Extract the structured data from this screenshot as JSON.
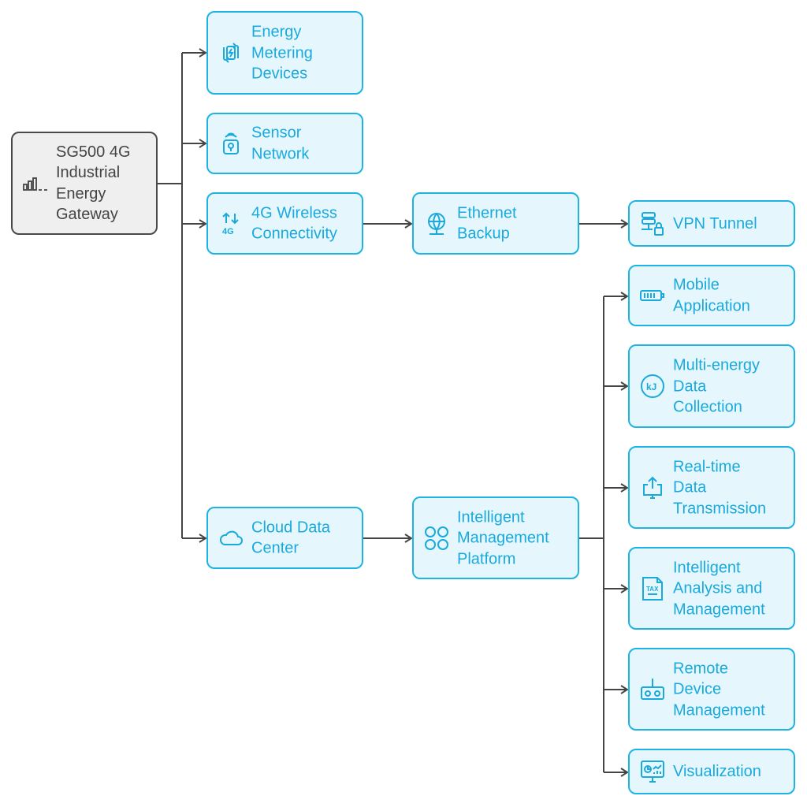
{
  "colors": {
    "node_border": "#1db3e3",
    "node_fill": "#e5f7fd",
    "node_text": "#1aa9dd",
    "root_border": "#4a4a4a",
    "root_fill": "#efefef",
    "root_text": "#444444",
    "connector": "#444444"
  },
  "nodes": {
    "root": {
      "label": "SG500 4G\nIndustrial\nEnergy\nGateway",
      "icon": "signal-bars-icon"
    },
    "energy_metering": {
      "label": "Energy\nMetering\nDevices",
      "icon": "battery-sync-icon"
    },
    "sensor_network": {
      "label": "Sensor\nNetwork",
      "icon": "wireless-sensor-icon"
    },
    "wireless_4g": {
      "label": "4G Wireless\nConnectivity",
      "icon": "4g-arrows-icon"
    },
    "ethernet_backup": {
      "label": "Ethernet\nBackup",
      "icon": "globe-network-icon"
    },
    "vpn_tunnel": {
      "label": "VPN Tunnel",
      "icon": "server-lock-icon"
    },
    "cloud_data_center": {
      "label": "Cloud Data\nCenter",
      "icon": "cloud-icon"
    },
    "management_platform": {
      "label": "Intelligent\nManagement\nPlatform",
      "icon": "apps-circles-icon"
    },
    "mobile_app": {
      "label": "Mobile\nApplication",
      "icon": "battery-icon"
    },
    "multi_energy": {
      "label": "Multi-energy\nData\nCollection",
      "icon": "kj-icon"
    },
    "realtime": {
      "label": "Real-time\nData\nTransmission",
      "icon": "monitor-upload-icon"
    },
    "analysis": {
      "label": "Intelligent\nAnalysis and\nManagement",
      "icon": "tax-document-icon"
    },
    "remote": {
      "label": "Remote\nDevice\nManagement",
      "icon": "remote-control-icon"
    },
    "visualization": {
      "label": "Visualization",
      "icon": "dashboard-monitor-icon"
    }
  }
}
